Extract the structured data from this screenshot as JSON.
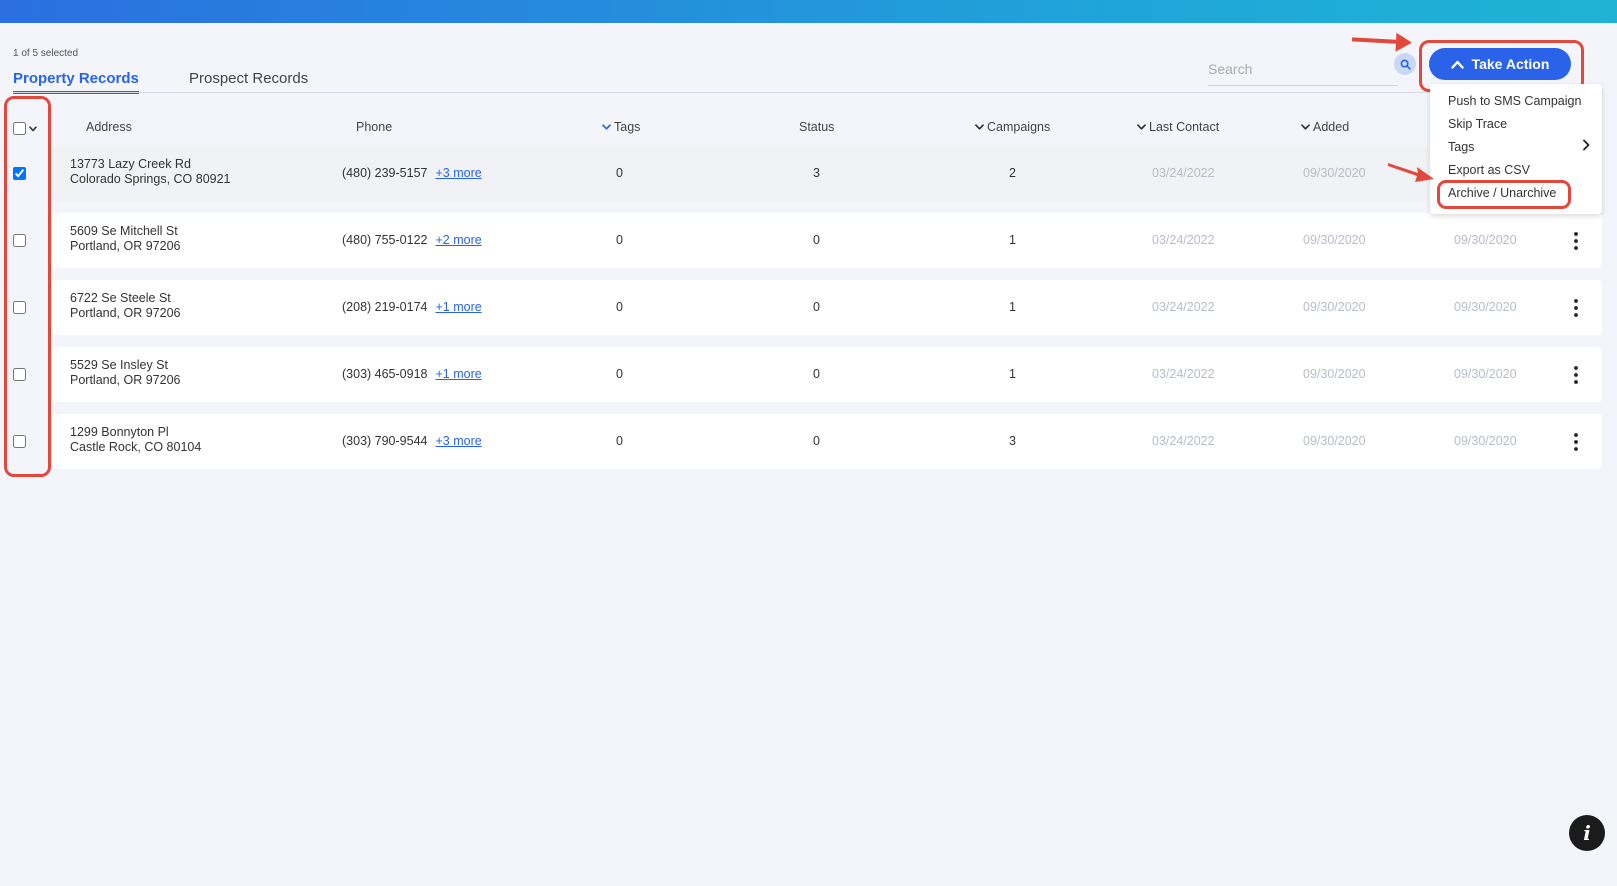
{
  "selection": {
    "text": "1 of 5 selected"
  },
  "tabs": [
    {
      "label": "Property Records",
      "active": true
    },
    {
      "label": "Prospect Records",
      "active": false
    }
  ],
  "search": {
    "placeholder": "Search",
    "value": ""
  },
  "take_action": {
    "label": "Take Action"
  },
  "menu": {
    "items": [
      {
        "label": "Push to SMS Campaign",
        "submenu": false
      },
      {
        "label": "Skip Trace",
        "submenu": false
      },
      {
        "label": "Tags",
        "submenu": true
      },
      {
        "label": "Export as CSV",
        "submenu": false
      },
      {
        "label": "Archive / Unarchive",
        "submenu": false,
        "highlighted": true
      }
    ]
  },
  "table": {
    "columns": [
      "Address",
      "Phone",
      "Tags",
      "Status",
      "Campaigns",
      "Last Contact",
      "Added"
    ],
    "rows": [
      {
        "checked": true,
        "address1": "13773 Lazy Creek Rd",
        "address2": "Colorado Springs, CO 80921",
        "phone": "(480) 239-5157",
        "more": "+3 more",
        "tags": "0",
        "status": "3",
        "campaigns": "2",
        "last_contact": "03/24/2022",
        "added": "09/30/2020",
        "extra_date": ""
      },
      {
        "checked": false,
        "address1": "5609 Se Mitchell St",
        "address2": "Portland, OR 97206",
        "phone": "(480) 755-0122",
        "more": "+2 more",
        "tags": "0",
        "status": "0",
        "campaigns": "1",
        "last_contact": "03/24/2022",
        "added": "09/30/2020",
        "extra_date": "09/30/2020"
      },
      {
        "checked": false,
        "address1": "6722 Se Steele St",
        "address2": "Portland, OR 97206",
        "phone": "(208) 219-0174",
        "more": "+1 more",
        "tags": "0",
        "status": "0",
        "campaigns": "1",
        "last_contact": "03/24/2022",
        "added": "09/30/2020",
        "extra_date": "09/30/2020"
      },
      {
        "checked": false,
        "address1": "5529 Se Insley St",
        "address2": "Portland, OR 97206",
        "phone": "(303) 465-0918",
        "more": "+1 more",
        "tags": "0",
        "status": "0",
        "campaigns": "1",
        "last_contact": "03/24/2022",
        "added": "09/30/2020",
        "extra_date": "09/30/2020"
      },
      {
        "checked": false,
        "address1": "1299 Bonnyton Pl",
        "address2": "Castle Rock, CO 80104",
        "phone": "(303) 790-9544",
        "more": "+3 more",
        "tags": "0",
        "status": "0",
        "campaigns": "3",
        "last_contact": "03/24/2022",
        "added": "09/30/2020",
        "extra_date": "09/30/2020"
      }
    ]
  },
  "colors": {
    "accent": "#2a63e8",
    "highlight": "#e3483c",
    "date_text": "#b8bcc6",
    "background": "#f3f5fb"
  },
  "icons": {
    "take_action": "chevron-up-icon",
    "search": "search-icon",
    "tags_submenu": "chevron-right-icon",
    "row_menu": "kebab-icon",
    "help": "info-icon"
  }
}
